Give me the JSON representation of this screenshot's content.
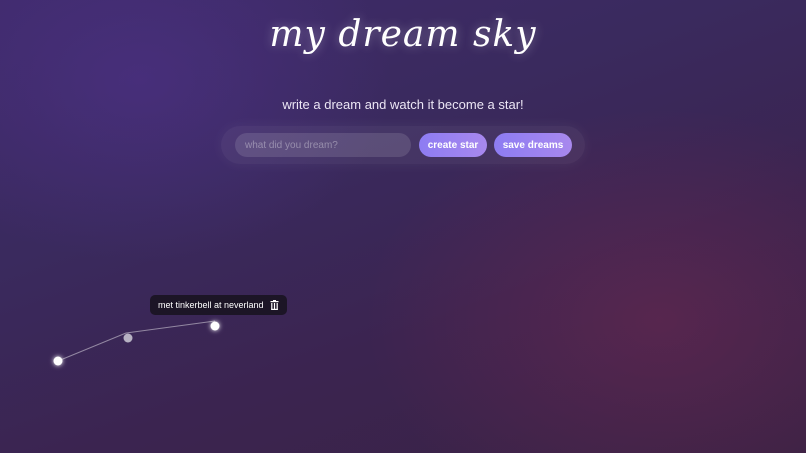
{
  "app": {
    "title": "my dream sky",
    "subtitle": "write a dream and watch it become a star!"
  },
  "form": {
    "input_placeholder": "what did you dream?",
    "input_value": "",
    "create_label": "create star",
    "save_label": "save dreams"
  },
  "tooltip": {
    "text": "met tinkerbell at neverland",
    "icon": "trash-icon"
  },
  "colors": {
    "accent_start": "#8d7cf2",
    "accent_end": "#a888ee",
    "tooltip_bg": "#1c1526",
    "star": "#ffffff",
    "star_dim": "#b7b2c3"
  }
}
